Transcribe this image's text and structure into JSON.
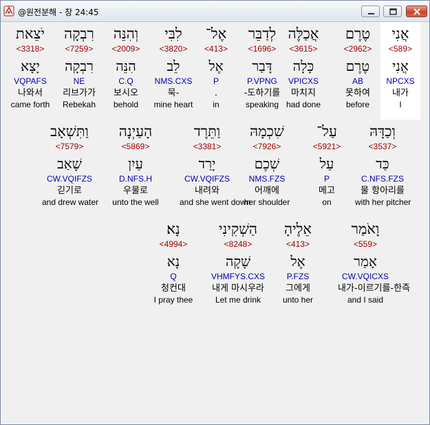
{
  "window": {
    "title": "@원전분해 - 창 24:45"
  },
  "colors": {
    "strong": "#a00000",
    "morph": "#0000b0",
    "highlight": "#ffffff",
    "background": "#f0f0f0"
  },
  "rows": [
    [
      {
        "hebrew": "אֲנִי",
        "strong": "<589>",
        "lemma": "אֲנִי",
        "morph": "NPCXS",
        "korean": "내가",
        "english": "I"
      },
      {
        "hebrew": "טֶרֶם",
        "strong": "<2962>",
        "lemma": "טֶרֶם",
        "morph": "AB",
        "korean": "못하여",
        "english": "before"
      },
      {
        "hebrew": "אֲכַלֶּה",
        "strong": "<3615>",
        "lemma": "כָּלָה",
        "morph": "VPICXS",
        "korean": "마치지",
        "english": "had done"
      },
      {
        "hebrew": "לְדַבֵּר",
        "strong": "<1696>",
        "lemma": "דָּבַר",
        "morph": "P.VPNG",
        "korean": "-도하기를",
        "english": "speaking"
      },
      {
        "hebrew": "אֶל־",
        "strong": "<413>",
        "lemma": "אֶל",
        "morph": "P",
        "korean": ".",
        "english": "in"
      },
      {
        "hebrew": "לִבִּי",
        "strong": "<3820>",
        "lemma": "לֵב",
        "morph": "NMS.CXS",
        "korean": "묵-",
        "english": "mine heart"
      },
      {
        "hebrew": "וְהִנֵּה",
        "strong": "<2009>",
        "lemma": "הִנֵּה",
        "morph": "C.Q",
        "korean": "보시오",
        "english": "behold"
      },
      {
        "hebrew": "רִבְקָה",
        "strong": "<7259>",
        "lemma": "רִבְקָה",
        "morph": "NE",
        "korean": "리브가가",
        "english": "Rebekah"
      },
      {
        "hebrew": "יֹצֵאת",
        "strong": "<3318>",
        "lemma": "יָצָא",
        "morph": "VQPAFS",
        "korean": "나와서",
        "english": "came forth"
      }
    ],
    [
      {
        "hebrew": "וְכַדָּהּ",
        "strong": "<3537>",
        "lemma": "כַּד",
        "morph": "C.NFS.FZS",
        "korean": "물 항아리를",
        "english": "with her pitcher"
      },
      {
        "hebrew": "עַל־",
        "strong": "<5921>",
        "lemma": "עַל",
        "morph": "P",
        "korean": "메고",
        "english": "on"
      },
      {
        "hebrew": "שִׁכְמָהּ",
        "strong": "<7926>",
        "lemma": "שְׁכֶם",
        "morph": "NMS.FZS",
        "korean": "어깨에",
        "english": "her shoulder"
      },
      {
        "hebrew": "וַתֵּרֶד",
        "strong": "<3381>",
        "lemma": "יָרַד",
        "morph": "CW.VQIFZS",
        "korean": "내려와",
        "english": "and she went down"
      },
      {
        "hebrew": "הָעַיְנָה",
        "strong": "<5869>",
        "lemma": "עַיִן",
        "morph": "D.NFS.H",
        "korean": "우물로",
        "english": "unto the well"
      },
      {
        "hebrew": "וַתִּשְׁאָב",
        "strong": "<7579>",
        "lemma": "שָׁאַב",
        "morph": "CW.VQIFZS",
        "korean": "긷기로",
        "english": "and drew water"
      }
    ],
    [
      {
        "hebrew": "וָאֹמַר",
        "strong": "<559>",
        "lemma": "אָמַר",
        "morph": "CW.VQICXS",
        "korean": "내가-이르기를-한즉",
        "english": "and I said"
      },
      {
        "hebrew": "אֵלֶיהָ",
        "strong": "<413>",
        "lemma": "אֶל",
        "morph": "P.FZS",
        "korean": "그에게",
        "english": "unto her"
      },
      {
        "hebrew": "הַשְׁקִינִי",
        "strong": "<8248>",
        "lemma": "שָׁקָה",
        "morph": "VHMFYS.CXS",
        "korean": "내게 마시우라",
        "english": "Let me drink"
      },
      {
        "hebrew": "נָא׃",
        "strong": "<4994>",
        "lemma": "נָא",
        "morph": "Q",
        "korean": "청컨대",
        "english": "I pray thee"
      }
    ]
  ]
}
